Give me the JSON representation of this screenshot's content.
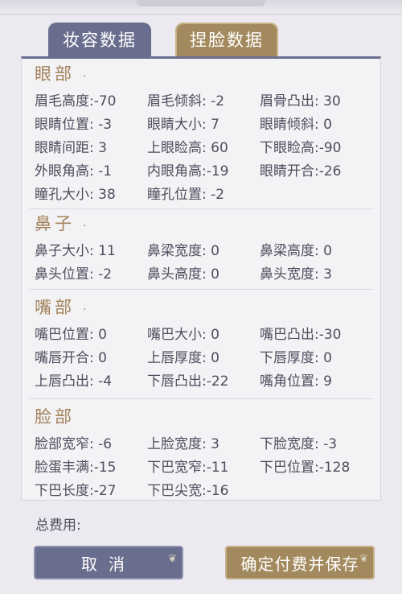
{
  "tabs": [
    {
      "label": "妆容数据"
    },
    {
      "label": "捏脸数据"
    }
  ],
  "sections": {
    "eyes": {
      "title": "眼部",
      "dot": "·",
      "items": [
        "眉毛高度:-70",
        "眉毛倾斜: -2",
        "眉骨凸出: 30",
        "眼睛位置: -3",
        "眼睛大小: 7",
        "眼睛倾斜: 0",
        "眼睛间距: 3",
        "上眼睑高: 60",
        "下眼睑高:-90",
        "外眼角高: -1",
        "内眼角高:-19",
        "眼睛开合:-26",
        "瞳孔大小: 38",
        "瞳孔位置: -2"
      ]
    },
    "nose": {
      "title": "鼻子",
      "dot": "·",
      "items": [
        "鼻子大小: 11",
        "鼻梁宽度: 0",
        "鼻梁高度: 0",
        "鼻头位置: -2",
        "鼻头高度: 0",
        "鼻头宽度: 3"
      ]
    },
    "mouth": {
      "title": "嘴部",
      "dot": "·",
      "items": [
        "嘴巴位置: 0",
        "嘴巴大小: 0",
        "嘴巴凸出:-30",
        "嘴唇开合: 0",
        "上唇厚度: 0",
        "下唇厚度: 0",
        "上唇凸出: -4",
        "下唇凸出:-22",
        "嘴角位置: 9"
      ]
    },
    "face": {
      "title": "脸部",
      "items": [
        "脸部宽窄: -6",
        "上脸宽度: 3",
        "下脸宽度: -3",
        "脸蛋丰满:-15",
        "下巴宽窄:-11",
        "下巴位置:-128",
        "下巴长度:-27",
        "下巴尖宽:-16"
      ]
    }
  },
  "footer": {
    "total_label": "总费用:",
    "cancel_label": "取消",
    "save_label": "确定付费并保存"
  },
  "colors": {
    "accent_blue": "#6a6e8e",
    "accent_gold": "#a38a5e",
    "section_title": "#a2825a"
  }
}
